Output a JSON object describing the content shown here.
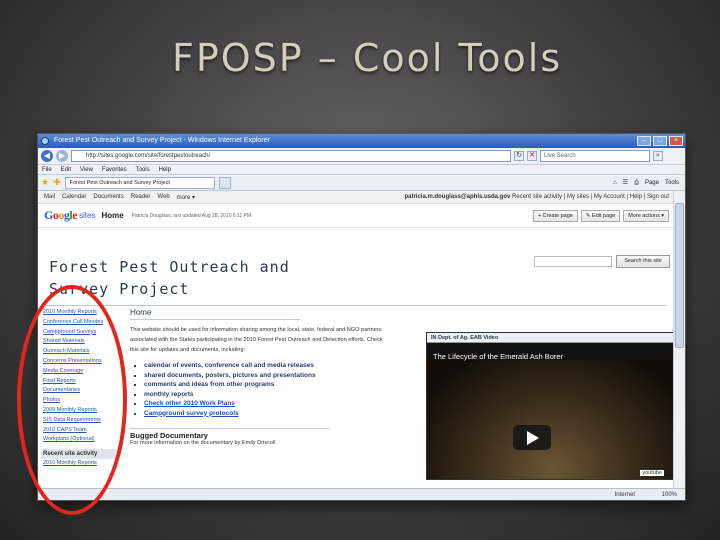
{
  "slide": {
    "title": "FPOSP – Cool Tools"
  },
  "browser": {
    "window_title": "Forest Pest Outreach and Survey Project - Windows Internet Explorer",
    "address": "http://sites.google.com/site/forestpestoutreach/",
    "search_placeholder": "Live Search",
    "menu": [
      "File",
      "Edit",
      "View",
      "Favorites",
      "Tools",
      "Help"
    ],
    "tab_title": "Forest Pest Outreach and Survey Project",
    "command_bar": [
      "Page",
      "Tools"
    ],
    "status_zone": "Internet",
    "zoom": "100%"
  },
  "google_bar": {
    "links": [
      "Mail",
      "Calendar",
      "Documents",
      "Reader",
      "Web",
      "more ▾"
    ],
    "email": "patricia.m.douglass@aphis.usda.gov",
    "right_links": "Recent site activity | My sites | My Account | Help | Sign out"
  },
  "sites_header": {
    "logo": [
      "G",
      "o",
      "o",
      "g",
      "l",
      "e"
    ],
    "logo_suffix": "sites",
    "page_title": "Home",
    "updated": "Patricia Douglass, last updated Aug 28, 2010 6:11 PM",
    "buttons": [
      "+ Create page",
      "✎ Edit page",
      "More actions ▾"
    ]
  },
  "site": {
    "title_line1": "Forest Pest Outreach and",
    "title_line2": "Survey Project",
    "search_button": "Search this site"
  },
  "sidebar": {
    "items": [
      "2010 Monthly Reports",
      "Conference Call Minutes",
      "Campground Surveys",
      "Shared Materials",
      "Outreach Materials",
      "Concerns Presentations",
      "Media Coverage",
      "Final Reports",
      "Documentaries",
      "Photos",
      "2009 Monthly Reports",
      "SIS Data Requirements",
      "2010 CAPS Team",
      "Workplans (Optional)"
    ],
    "recent_heading": "Recent site activity",
    "recent_item": "2010 Monthly Reports"
  },
  "main": {
    "heading": "Home",
    "intro": "This website should be used for information sharing among the local, state, federal and NGO partners associated with the States participating in the 2010 Forest Pest Outreach and Detection efforts. Check this site for updates and documents, including:",
    "bullets": [
      "calendar of events, conference call and media releases",
      "shared documents, posters, pictures and presentations",
      "comments and ideas from other programs",
      "monthly reports",
      "Check other 2010 Work Plans",
      "Campground survey protocols"
    ],
    "link_bullets": [
      4,
      5
    ],
    "bugged_title": "Bugged Documentary",
    "bugged_desc": "For more information on the documentary by Emily Driscoll"
  },
  "video": {
    "header": "IN Dept. of Ag. EAB Video",
    "title": "The Lifecycle of the Emerald Ash Borer",
    "credit": "youtube"
  }
}
